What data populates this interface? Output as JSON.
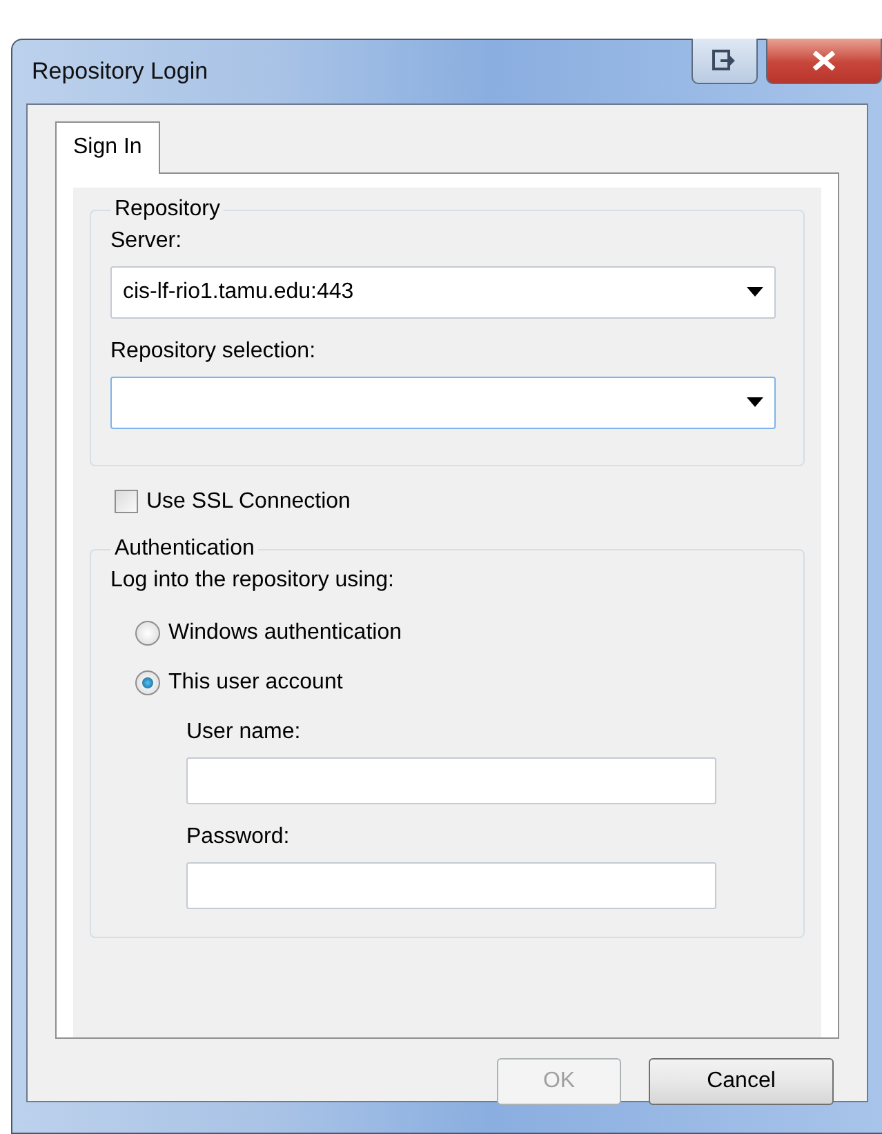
{
  "window": {
    "title": "Repository Login"
  },
  "tabs": [
    {
      "label": "Sign In",
      "selected": true
    }
  ],
  "repository": {
    "title": "Repository",
    "server": {
      "label": "Server:",
      "value": "cis-lf-rio1.tamu.edu:443"
    },
    "selection": {
      "label": "Repository selection:"
    }
  },
  "ssl": {
    "label": "Use SSL Connection",
    "checked": false
  },
  "authentication": {
    "title": "Authentication",
    "prompt": "Log into the repository using:",
    "options": [
      {
        "label": "Windows authentication",
        "selected": false
      },
      {
        "label": "This user account",
        "selected": true
      }
    ],
    "user_name": {
      "label": "User name:"
    },
    "password": {
      "label": "Password:"
    }
  },
  "buttons": [
    {
      "label": "OK",
      "disabled": true
    },
    {
      "label": "Cancel",
      "disabled": false
    }
  ]
}
